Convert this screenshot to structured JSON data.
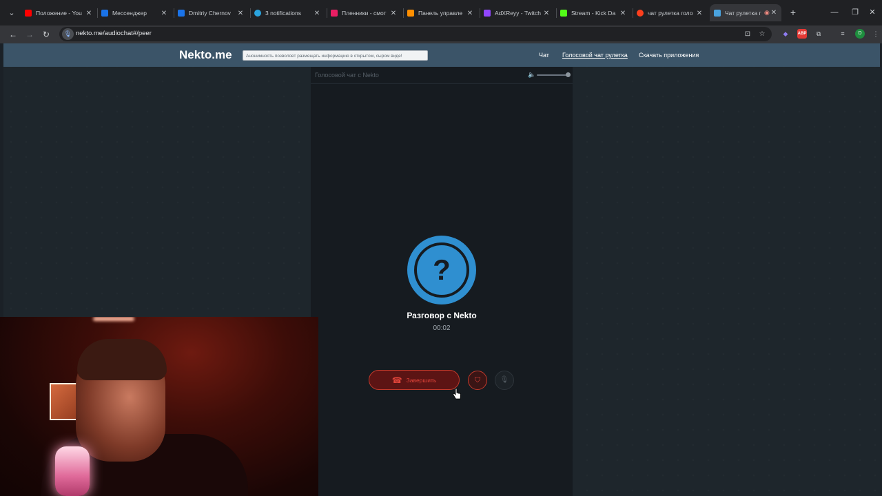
{
  "browser": {
    "tabs": [
      {
        "label": "Положение - You",
        "favicon_color": "#ff0000",
        "icon": "youtube-icon"
      },
      {
        "label": "Мессенджер",
        "favicon_color": "#1a73e8",
        "icon": "messenger-icon"
      },
      {
        "label": "Dmitriy Chernov",
        "favicon_color": "#1a73e8",
        "icon": "vk-icon"
      },
      {
        "label": "3 notifications",
        "favicon_color": "#2aa3de",
        "icon": "telegram-icon"
      },
      {
        "label": "Пленники - смот",
        "favicon_color": "#e91e63",
        "icon": "video-icon"
      },
      {
        "label": "Панель управле",
        "favicon_color": "#ff8f00",
        "icon": "donation-icon"
      },
      {
        "label": "AdXReyy - Twitch",
        "favicon_color": "#9146ff",
        "icon": "twitch-icon"
      },
      {
        "label": "Stream - Kick Da",
        "favicon_color": "#53fc18",
        "icon": "kick-icon"
      },
      {
        "label": "чат рулетка голо",
        "favicon_color": "#fc3f1d",
        "icon": "yandex-icon"
      },
      {
        "label": "Чат рулетка г",
        "favicon_color": "#4aa3df",
        "icon": "nekto-icon",
        "active": true
      }
    ],
    "url": "nekto.me/audiochat#/peer"
  },
  "site": {
    "logo": "Nekto.me",
    "notice": "Анонимность позволяет размещать информацию в открытом, сыром виде!",
    "nav": {
      "chat": "Чат",
      "voice_roulette": "Голосовой чат рулетка",
      "download_apps": "Скачать приложения"
    }
  },
  "call": {
    "panel_title": "Голосовой чат с Nekto",
    "avatar_symbol": "?",
    "partner_name": "Разговор с Nekto",
    "timer": "00:02",
    "end_button_label": "Завершить",
    "volume_level": 1.0
  },
  "colors": {
    "accent_blue": "#2f8fd0",
    "danger_red": "#e0443a",
    "site_header": "#3b5468"
  }
}
